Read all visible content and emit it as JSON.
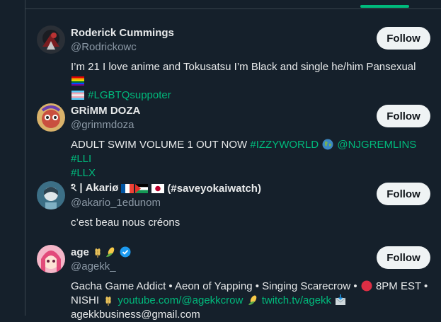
{
  "colors": {
    "background": "#15202b",
    "accent": "#00ba7c",
    "follow_bg": "#eff3f4",
    "muted": "#8b98a5"
  },
  "users": [
    {
      "name": "Roderick Cummings",
      "handle": "@Rodrickowc",
      "follow_label": "Follow",
      "bio_line1": "I’m 21 I love anime and Tokusatsu I’m Black and single he/him Pansexual",
      "bio_line2_tag": "#LGBTQsuppoter",
      "icons": [
        "rainbow-flag-icon",
        "transgender-flag-icon"
      ]
    },
    {
      "name": "GRiMM DOZA",
      "handle": "@grimmdoza",
      "follow_label": "Follow",
      "bio_text": "ADULT SWIM VOLUME 1 OUT NOW",
      "bio_tag1": "#IZZYWORLD",
      "bio_tag2": "@NJGREMLINS",
      "bio_tag3": "#LLI",
      "bio_tag4": "#LLX",
      "icons": [
        "globe-icon"
      ]
    },
    {
      "name_prefix": "ঽ | Akariø",
      "name_suffix": "(#saveyokaiwatch)",
      "handle": "@akario_1edunom",
      "follow_label": "Follow",
      "bio_text": "c’est beau nous créons",
      "icons": [
        "france-flag-icon",
        "palestine-flag-icon",
        "japan-flag-icon"
      ]
    },
    {
      "name": "age",
      "handle": "@agekk_",
      "follow_label": "Follow",
      "bio_line1": "Gacha Game Addict • Aeon of Yapping • Singing Scarecrow •",
      "bio_line1_end": "8PM EST •",
      "bio_line2_start": "NISHI",
      "bio_link1": "youtube.com/@agekkcrow",
      "bio_link2": "twitch.tv/agekk",
      "bio_line3": "agekkbusiness@gmail.com",
      "icons": [
        "wheat-icon",
        "corn-icon",
        "verified-badge-icon",
        "red-circle-icon",
        "envelope-icon"
      ]
    }
  ]
}
